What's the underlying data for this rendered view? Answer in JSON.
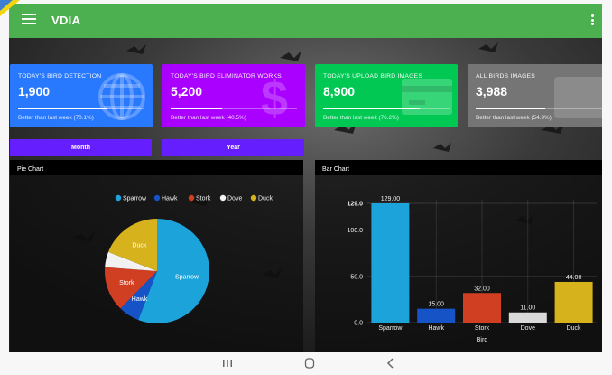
{
  "app_bar": {
    "title": "VDIA",
    "menu_icon": "menu-icon",
    "overflow_icon": "more-vert-icon"
  },
  "cards": [
    {
      "title": "TODAY'S BIRD DETECTION",
      "value": "1,900",
      "footer": "Better than last week (70.1%)",
      "progress": 0.701,
      "color": "#2979ff",
      "icon": "globe-icon"
    },
    {
      "title": "TODAY'S BIRD ELIMINATOR WORKS",
      "value": "5,200",
      "footer": "Better than last week (40.5%)",
      "progress": 0.405,
      "color": "#aa00ff",
      "icon": "dollar-icon"
    },
    {
      "title": "TODAY'S UPLOAD BIRD IMAGES",
      "value": "8,900",
      "footer": "Better than last week (76.2%)",
      "progress": 0.762,
      "color": "#00c853",
      "icon": "card-icon"
    },
    {
      "title": "ALL BIRDS IMAGES",
      "value": "3,988",
      "footer": "Better than last week (54.9%)",
      "progress": 0.549,
      "color": "#757575",
      "icon": "image-icon"
    }
  ],
  "period_buttons": {
    "month": "Month",
    "year": "Year"
  },
  "pie_panel": {
    "title": "Pie Chart"
  },
  "bar_panel": {
    "title": "Bar Chart"
  },
  "chart_data": [
    {
      "type": "pie",
      "title": "",
      "legend_placement": "top-center",
      "categories": [
        "Sparrow",
        "Hawk",
        "Stork",
        "Dove",
        "Duck"
      ],
      "values": [
        129,
        15,
        32,
        11,
        44
      ],
      "colors": [
        "#1ca3d9",
        "#1553c7",
        "#d13f22",
        "#f2f2f2",
        "#d6b21c"
      ],
      "slice_labels": [
        "Sparrow",
        "Hawk",
        "Stork",
        "",
        "Duck"
      ]
    },
    {
      "type": "bar",
      "title": "",
      "xlabel": "Bird",
      "ylabel": "",
      "categories": [
        "Sparrow",
        "Hawk",
        "Stork",
        "Dove",
        "Duck"
      ],
      "values": [
        129,
        15,
        32,
        11,
        44
      ],
      "value_labels": [
        "129.00",
        "15.00",
        "32.00",
        "11.00",
        "44.00"
      ],
      "colors": [
        "#1ca3d9",
        "#1553c7",
        "#d13f22",
        "#d9d9d9",
        "#d6b21c"
      ],
      "yticks": [
        0,
        50,
        100,
        129
      ],
      "ytick_labels": [
        "0.0",
        "50.0",
        "100.0",
        "129.0"
      ],
      "ylim": [
        0,
        129
      ],
      "grid": true
    }
  ],
  "nav_bar": {
    "recents_icon": "recents-icon",
    "home_icon": "home-icon",
    "back_icon": "back-icon"
  }
}
